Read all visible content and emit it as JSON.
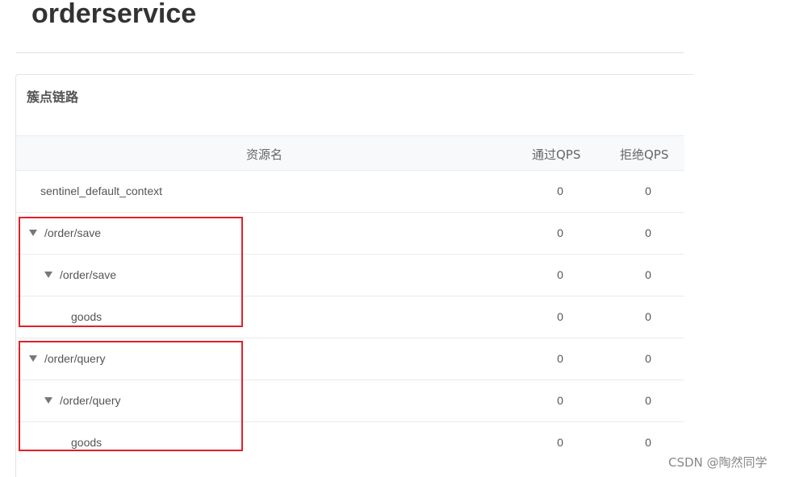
{
  "app": {
    "title": "orderservice"
  },
  "panel": {
    "title": "簇点链路"
  },
  "table": {
    "columns": {
      "resource": "资源名",
      "pass_qps": "通过QPS",
      "block_qps": "拒绝QPS"
    },
    "rows": [
      {
        "name": "sentinel_default_context",
        "level": 0,
        "expandable": false,
        "pass_qps": "0",
        "block_qps": "0"
      },
      {
        "name": "/order/save",
        "level": 0,
        "expandable": true,
        "expanded": true,
        "pass_qps": "0",
        "block_qps": "0"
      },
      {
        "name": "/order/save",
        "level": 1,
        "expandable": true,
        "expanded": true,
        "pass_qps": "0",
        "block_qps": "0"
      },
      {
        "name": "goods",
        "level": 2,
        "expandable": false,
        "pass_qps": "0",
        "block_qps": "0"
      },
      {
        "name": "/order/query",
        "level": 0,
        "expandable": true,
        "expanded": true,
        "pass_qps": "0",
        "block_qps": "0"
      },
      {
        "name": "/order/query",
        "level": 1,
        "expandable": true,
        "expanded": true,
        "pass_qps": "0",
        "block_qps": "0"
      },
      {
        "name": "goods",
        "level": 2,
        "expandable": false,
        "pass_qps": "0",
        "block_qps": "0"
      }
    ]
  },
  "annotations": {
    "highlight_color": "#e0202a"
  },
  "watermark": {
    "text": "CSDN @陶然同学"
  }
}
